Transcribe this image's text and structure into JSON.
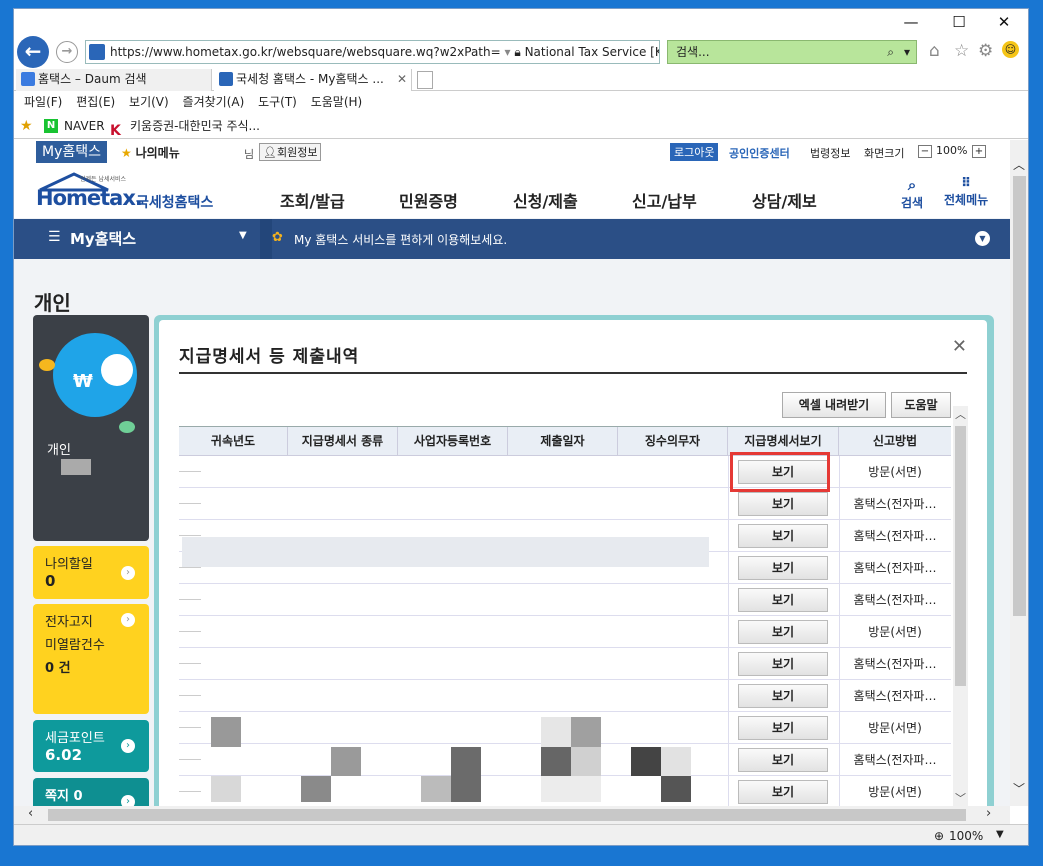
{
  "browser": {
    "address_url": "https://www.hometax.go.kr/websquare/websquare.wq?w2xPath=",
    "site_identity": "National Tax Service [KR]",
    "search_placeholder": "검색...",
    "tabs": [
      {
        "label": "홈택스 – Daum 검색"
      },
      {
        "label": "국세청 홈택스 - My홈택스 ..."
      }
    ],
    "menu": [
      "파일(F)",
      "편집(E)",
      "보기(V)",
      "즐겨찾기(A)",
      "도구(T)",
      "도움말(H)"
    ],
    "favorites": [
      "NAVER",
      "키움증권-대한민국 주식..."
    ],
    "zoom": "100%"
  },
  "util": {
    "my_tab": "My홈택스",
    "my_menu": "나의메뉴",
    "user_suffix": "님",
    "member_info": "회원정보",
    "logout": "로그아웃",
    "cert_center": "공인인증센터",
    "law_info": "법령정보",
    "screen_size": "화면크기",
    "zoom_level": "100%"
  },
  "header": {
    "logo_small": "언제든 납세서비스",
    "logo_main": "Hometax.",
    "logo_sub": "국세청홈택스",
    "nav": [
      "조회/발급",
      "민원증명",
      "신청/제출",
      "신고/납부",
      "상담/제보"
    ],
    "search_label": "검색",
    "all_menu_label": "전체메뉴"
  },
  "bluebar": {
    "title": "My홈택스",
    "notice": "My 홈택스 서비스를 편하게 이용해보세요."
  },
  "page_title": "개인",
  "left_panel": {
    "profile_label": "개인",
    "todo_label": "나의할일",
    "todo_count": "0",
    "notice_label_1": "전자고지",
    "notice_label_2": "미열람건수",
    "notice_count": "0 건",
    "points_label": "세금포인트",
    "points_value": "6.02",
    "bottom_label": "쪽지 0"
  },
  "modal": {
    "title": "지급명세서 등 제출내역",
    "excel_button": "엑셀 내려받기",
    "help_button": "도움말",
    "columns": [
      "귀속년도",
      "지급명세서 종류",
      "사업자등록번호",
      "제출일자",
      "징수의무자",
      "지급명세서보기",
      "신고방법"
    ],
    "view_label": "보기",
    "rows": [
      {
        "method": "방문(서면)"
      },
      {
        "method": "홈택스(전자파…"
      },
      {
        "method": "홈택스(전자파…"
      },
      {
        "method": "홈택스(전자파…"
      },
      {
        "method": "홈택스(전자파…"
      },
      {
        "method": "방문(서면)"
      },
      {
        "method": "홈택스(전자파…"
      },
      {
        "method": "홈택스(전자파…"
      },
      {
        "method": "방문(서면)"
      },
      {
        "method": "홈택스(전자파…"
      },
      {
        "method": "방문(서면)"
      }
    ]
  },
  "colors": {
    "accent": "#2b4f86",
    "highlight_red": "#e53935",
    "yellow": "#ffd21f",
    "teal": "#0e9a9c"
  }
}
